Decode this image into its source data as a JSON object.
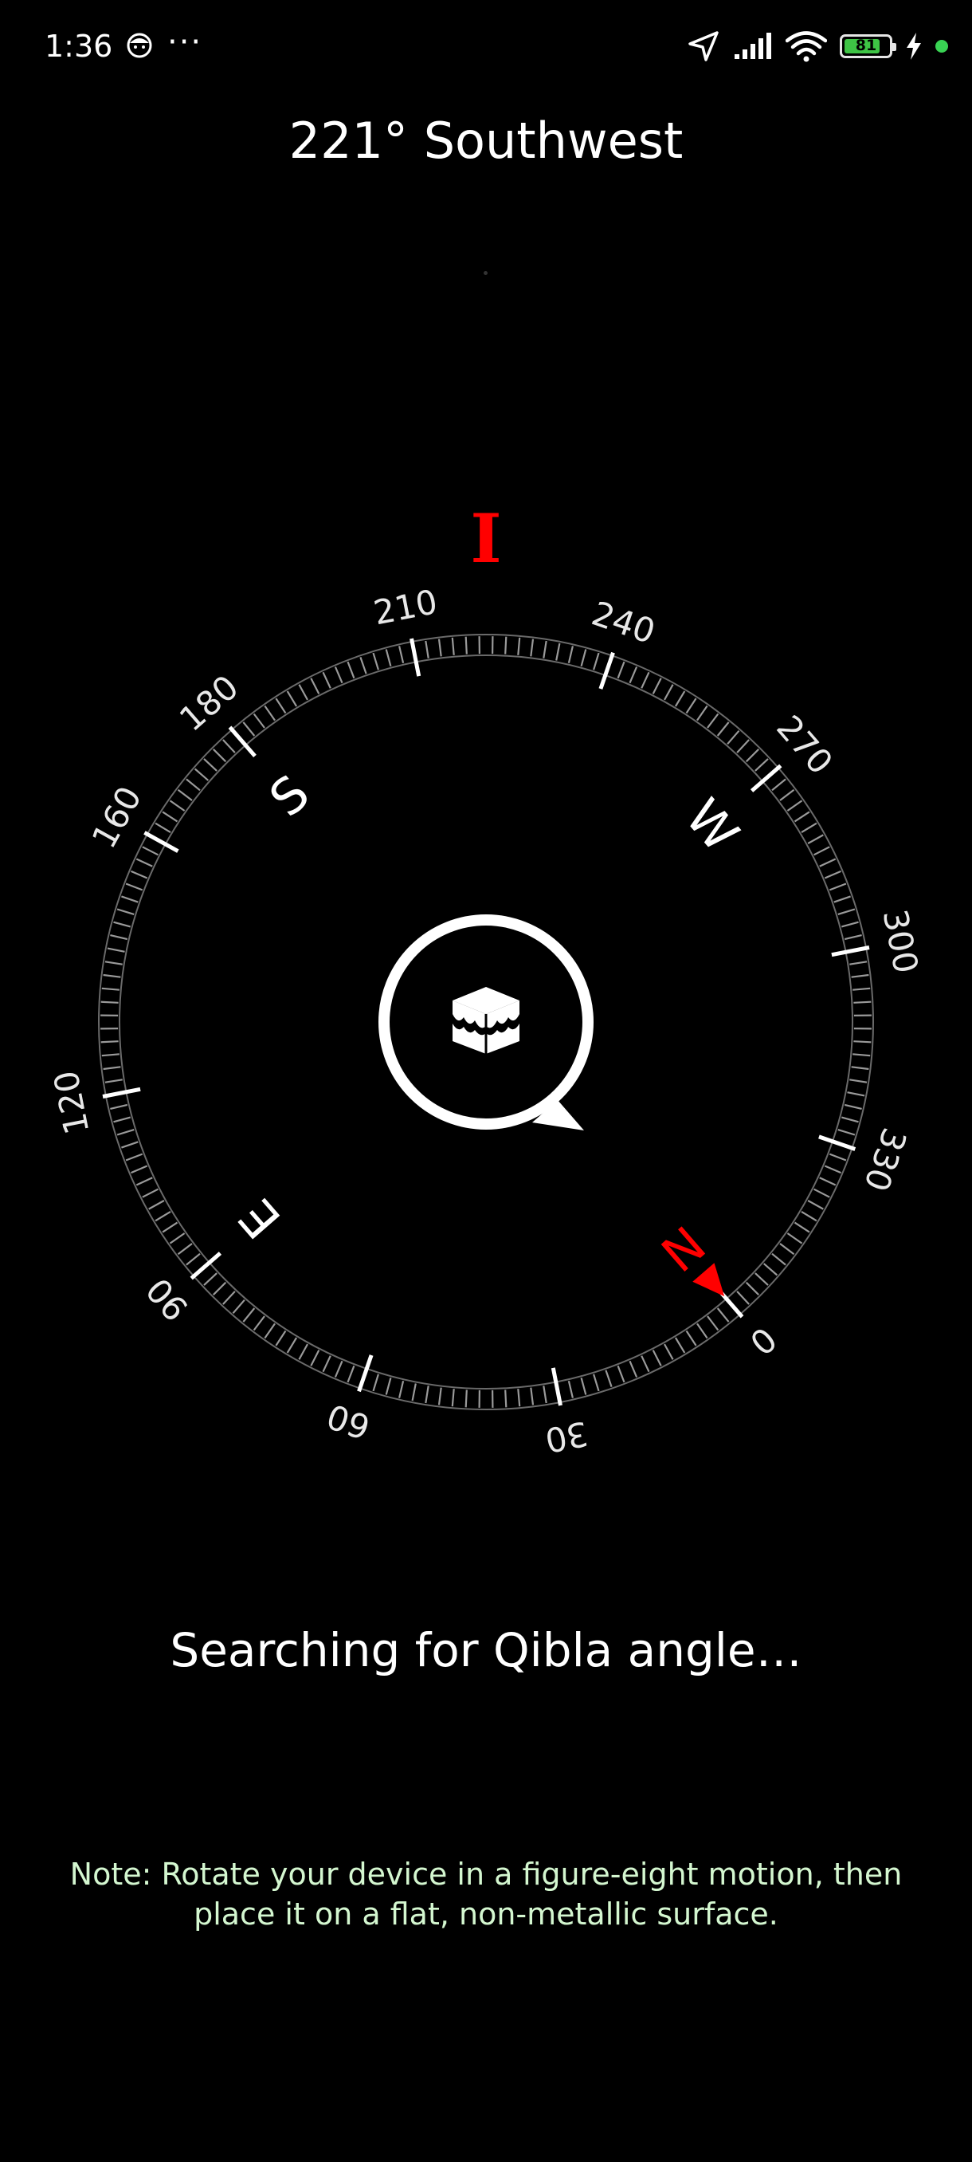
{
  "status_bar": {
    "time": "1:36",
    "overflow_dots": "···",
    "battery_level": "81",
    "battery_fraction": 0.81,
    "icons": [
      "face-icon",
      "location-arrow-icon",
      "cellular-signal-icon",
      "wifi-icon",
      "battery-icon",
      "charging-bolt-icon",
      "green-dot-indicator"
    ]
  },
  "heading": {
    "text": "221° Southwest",
    "degrees": 221
  },
  "compass": {
    "qibla_marker": "I",
    "cardinals": {
      "north": "N",
      "east": "E",
      "south": "S",
      "west": "W"
    },
    "degree_labels": [
      "0",
      "30",
      "60",
      "90",
      "120",
      "160",
      "180",
      "210",
      "240",
      "270",
      "300",
      "330"
    ],
    "center_icon": "kaaba-icon",
    "colors": {
      "north": "#ff0000",
      "marker": "#ff0000",
      "ring": "#9a9a9a",
      "ticks_major": "#ffffff",
      "labels": "#e8e8e8"
    }
  },
  "status_message": "Searching for Qibla angle…",
  "note": "Note: Rotate your device in a figure-eight motion, then place it on a flat, non-metallic surface."
}
